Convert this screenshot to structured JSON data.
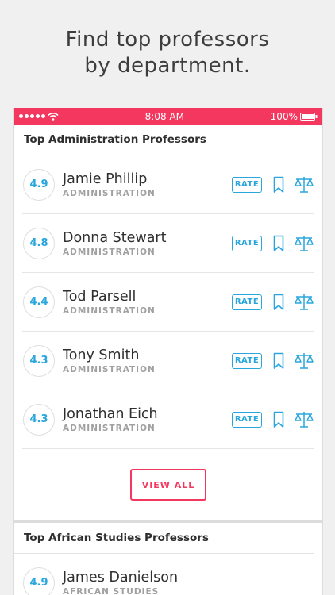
{
  "headline": {
    "line1": "Find top professors",
    "line2": "by department."
  },
  "status_bar": {
    "time": "8:08 AM",
    "battery": "100%"
  },
  "sections": [
    {
      "title": "Top Administration Professors",
      "professors": [
        {
          "rating": "4.9",
          "name": "Jamie Phillip",
          "department": "ADMINISTRATION"
        },
        {
          "rating": "4.8",
          "name": "Donna Stewart",
          "department": "ADMINISTRATION"
        },
        {
          "rating": "4.4",
          "name": "Tod Parsell",
          "department": "ADMINISTRATION"
        },
        {
          "rating": "4.3",
          "name": "Tony Smith",
          "department": "ADMINISTRATION"
        },
        {
          "rating": "4.3",
          "name": "Jonathan Eich",
          "department": "ADMINISTRATION"
        }
      ],
      "view_all_label": "VIEW ALL"
    },
    {
      "title": "Top African Studies Professors",
      "professors": [
        {
          "rating": "4.9",
          "name": "James Danielson",
          "department": "AFRICAN STUDIES"
        }
      ]
    }
  ],
  "rate_label": "RATE",
  "colors": {
    "accent_red": "#f4375f",
    "accent_blue": "#2aa6dd"
  },
  "icons": {
    "bookmark": "bookmark-icon",
    "compare": "scale-icon",
    "wifi": "wifi-icon"
  }
}
